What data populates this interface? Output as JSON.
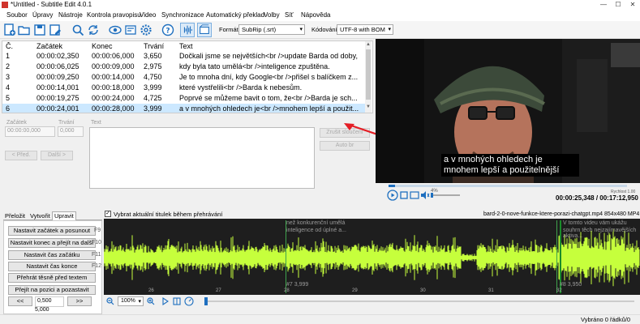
{
  "window": {
    "title": "*Untitled - Subtitle Edit 4.0.1"
  },
  "menu": [
    "Soubor",
    "Úpravy",
    "Nástroje",
    "Kontrola pravopisu",
    "Video",
    "Synchronizace",
    "Automatický překlad",
    "Volby",
    "Síť",
    "Nápověda"
  ],
  "toolbar": {
    "format_label": "Formát",
    "format_value": "SubRip (.srt)",
    "encoding_label": "Kódování",
    "encoding_value": "UTF-8 with BOM"
  },
  "table": {
    "headers": [
      "Č.",
      "Začátek",
      "Konec",
      "Trvání",
      "Text"
    ],
    "rows": [
      [
        "1",
        "00:00:02,350",
        "00:00:06,000",
        "3,650",
        "Dočkali jsme se největších<br />update Barda od doby,"
      ],
      [
        "2",
        "00:00:06,025",
        "00:00:09,000",
        "2,975",
        "kdy byla tato umělá<br />inteligence zpuštěna."
      ],
      [
        "3",
        "00:00:09,250",
        "00:00:14,000",
        "4,750",
        "Je to mnoha dní, kdy Google<br />přišel s balíčkem z..."
      ],
      [
        "4",
        "00:00:14,001",
        "00:00:18,000",
        "3,999",
        "které vystřelili<br />Barda k nebesům."
      ],
      [
        "5",
        "00:00:19,275",
        "00:00:24,000",
        "4,725",
        "Poprvé se můžeme bavit o tom, že<br />Barda je sch..."
      ],
      [
        "6",
        "00:00:24,001",
        "00:00:28,000",
        "3,999",
        "a v mnohých ohledech je<br />mnohem lepší a použit..."
      ]
    ]
  },
  "editor": {
    "start_label": "Začátek",
    "duration_label": "Trvání",
    "text_label": "Text",
    "start_value": "00:00:00,000",
    "duration_value": "0,000",
    "prev_label": "< Před.",
    "next_label": "Další >",
    "split_label": "Zrušit sloučení",
    "auto_br_label": "Auto br"
  },
  "video": {
    "subtitle_line1": "a v mnohých ohledech je",
    "subtitle_line2": "mnohem lepší a použitelnější",
    "volume_pct": "4%",
    "speed_label": "Rychlost 1.00",
    "time_current": "00:00:25,348",
    "time_total": "00:17:12,950",
    "time_separator": " / "
  },
  "tabs": [
    "Přeložit",
    "Vytvořit",
    "Upravit"
  ],
  "waveform_checkbox": "Vybrat aktuální titulek během přehrávání",
  "video_file": "bard-2-0-nove-funkce-ktere-porazi-chatgpt.mp4 854x480 MP4",
  "create_buttons": [
    {
      "label": "Nastavit začátek a posunout",
      "key": "F9"
    },
    {
      "label": "Nastavit konec a přejít na další",
      "key": "F10"
    },
    {
      "label": "Nastavit čas začátku",
      "key": "F11"
    },
    {
      "label": "Nastavit čas konce",
      "key": "F12"
    },
    {
      "label": "Přehrát těsně před textem",
      "key": ""
    },
    {
      "label": "Přejít na pozici a pozastavit",
      "key": ""
    }
  ],
  "seek": {
    "back": "<<",
    "value": "0,500",
    "fwd": ">>",
    "value2": "5,000"
  },
  "waveform": {
    "seg1_text_a": "než konkurenční umělá",
    "seg1_text_b": "inteligence od úplné a...",
    "seg1_num": "#7  3,999",
    "seg2_text_a": "V tomto videu vám ukážu",
    "seg2_text_b": "souhrn těch nejzajímavějších aktiva...",
    "seg2_num": "#8  3,950",
    "ticks": [
      "26",
      "27",
      "28",
      "29",
      "30",
      "31",
      "32"
    ]
  },
  "zoom": "100%",
  "status": "Vybráno 0 řádků/0",
  "colors": {
    "waveform": "#c6ff3c",
    "selection": "#cce8ff",
    "arrow": "#e41e25"
  }
}
